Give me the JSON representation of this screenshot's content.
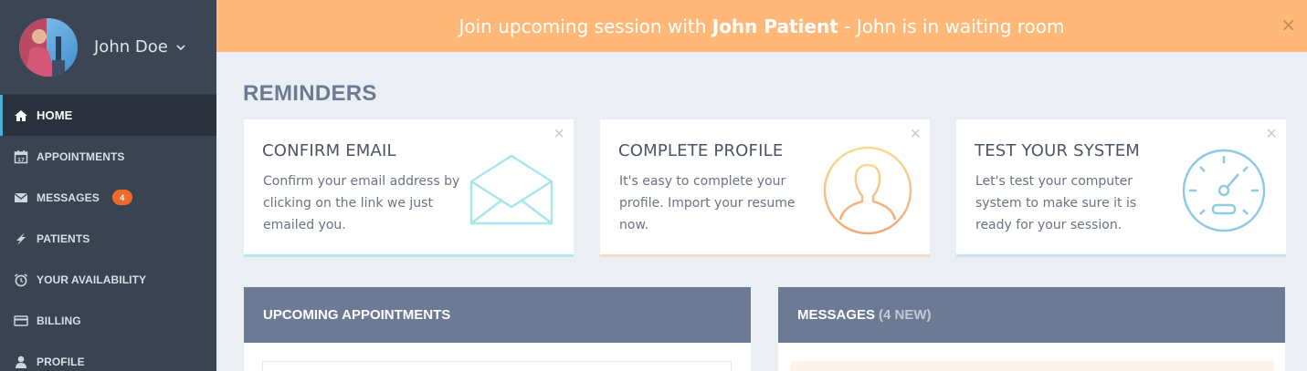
{
  "user": {
    "name": "John Doe"
  },
  "sidebar": {
    "items": [
      {
        "label": "HOME",
        "icon": "home-icon",
        "active": true
      },
      {
        "label": "APPOINTMENTS",
        "icon": "calendar-icon"
      },
      {
        "label": "MESSAGES",
        "icon": "envelope-icon",
        "badge": "4"
      },
      {
        "label": "PATIENTS",
        "icon": "lightning-icon"
      },
      {
        "label": "YOUR AVAILABILITY",
        "icon": "alarm-clock-icon"
      },
      {
        "label": "BILLING",
        "icon": "credit-card-icon"
      },
      {
        "label": "PROFILE",
        "icon": "user-icon"
      }
    ]
  },
  "banner": {
    "prefix": "Join upcoming session with ",
    "name": "John Patient",
    "suffix": " - John is in waiting room",
    "close": "×"
  },
  "reminders": {
    "title": "REMINDERS",
    "cards": [
      {
        "title": "CONFIRM EMAIL",
        "text": "Confirm your email address by clicking on the link we just emailed you.",
        "close": "×",
        "icon": "envelope-outline-icon",
        "color": "#a7e6ea"
      },
      {
        "title": "COMPLETE PROFILE",
        "text": "It's easy to complete your profile. Import your resume now.",
        "close": "×",
        "icon": "person-circle-icon",
        "color": "#f4c48a"
      },
      {
        "title": "TEST YOUR SYSTEM",
        "text": "Let's test your computer system to make sure it is ready for your session.",
        "close": "×",
        "icon": "speedometer-icon",
        "color": "#8ec9e6"
      }
    ]
  },
  "panels": {
    "upcoming": {
      "title": "UPCOMING APPOINTMENTS"
    },
    "messages": {
      "title": "MESSAGES",
      "count": "(4 NEW)"
    }
  },
  "colors": {
    "sidebar": "#3a4352",
    "banner": "#ffb877",
    "panel_header": "#6c7a93",
    "accent": "#4fb0d6",
    "badge": "#f16a2b"
  }
}
